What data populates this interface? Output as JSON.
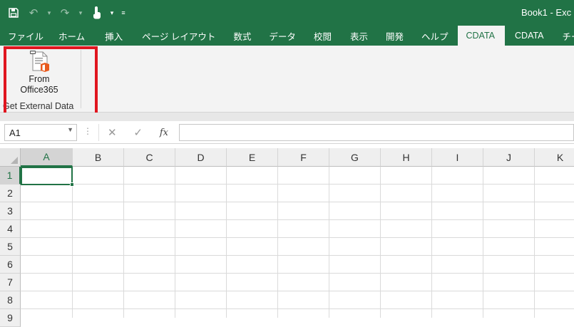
{
  "titlebar": {
    "title": "Book1  -  Exc",
    "qat": [
      "save-icon",
      "undo-icon",
      "redo-icon",
      "touch-mode-icon",
      "customize-qat-icon"
    ]
  },
  "tabs": [
    {
      "label": "ファイル"
    },
    {
      "label": "ホーム"
    },
    {
      "label": "挿入"
    },
    {
      "label": "ページ レイアウト"
    },
    {
      "label": "数式"
    },
    {
      "label": "データ"
    },
    {
      "label": "校閲"
    },
    {
      "label": "表示"
    },
    {
      "label": "開発"
    },
    {
      "label": "ヘルプ"
    },
    {
      "label": "CDATA",
      "active": true
    },
    {
      "label": "CDATA"
    },
    {
      "label": "チーム"
    }
  ],
  "ribbon": {
    "button_line1": "From",
    "button_line2": "Office365",
    "group_label": "Get External Data"
  },
  "formula_bar": {
    "name_box": "A1",
    "cancel_symbol": "✕",
    "enter_symbol": "✓",
    "fx_symbol": "fx",
    "formula": ""
  },
  "grid": {
    "columns": [
      "A",
      "B",
      "C",
      "D",
      "E",
      "F",
      "G",
      "H",
      "I",
      "J",
      "K"
    ],
    "rows": [
      "1",
      "2",
      "3",
      "4",
      "5",
      "6",
      "7",
      "8",
      "9"
    ],
    "active_cell": "A1"
  },
  "colors": {
    "excel_green": "#217346",
    "highlight_red": "#e0161f"
  }
}
